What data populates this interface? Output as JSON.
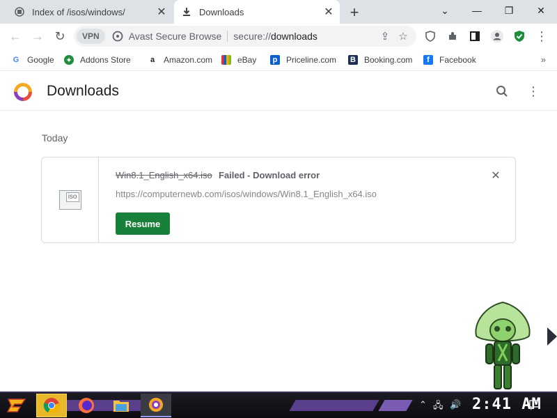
{
  "tabs": [
    {
      "title": "Index of /isos/windows/",
      "icon": "page-icon",
      "active": false
    },
    {
      "title": "Downloads",
      "icon": "download-icon",
      "active": true
    }
  ],
  "window_controls": {
    "minimize": "—",
    "restore": "❐",
    "close": "✕"
  },
  "toolbar": {
    "vpn_label": "VPN",
    "brand": "Avast Secure Browse",
    "url_scheme": "secure://",
    "url_path": "downloads"
  },
  "bookmarks": [
    {
      "label": "Google",
      "icon": "google-icon"
    },
    {
      "label": "Addons Store",
      "icon": "addons-store-icon"
    },
    {
      "label": "Amazon.com",
      "icon": "amazon-icon"
    },
    {
      "label": "eBay",
      "icon": "ebay-icon"
    },
    {
      "label": "Priceline.com",
      "icon": "priceline-icon"
    },
    {
      "label": "Booking.com",
      "icon": "booking-icon"
    },
    {
      "label": "Facebook",
      "icon": "facebook-icon"
    }
  ],
  "page": {
    "title": "Downloads",
    "section_label": "Today"
  },
  "download": {
    "filename": "Win8.1_English_x64.iso",
    "status": "Failed - Download error",
    "url": "https://computernewb.com/isos/windows/Win8.1_English_x64.iso",
    "file_badge": "iso",
    "resume_label": "Resume"
  },
  "taskbar": {
    "clock": "2:41 AM"
  },
  "colors": {
    "resume_button": "#188038",
    "tab_strip": "#dee1e6",
    "taskbar_accent": "#5a3f8c"
  }
}
